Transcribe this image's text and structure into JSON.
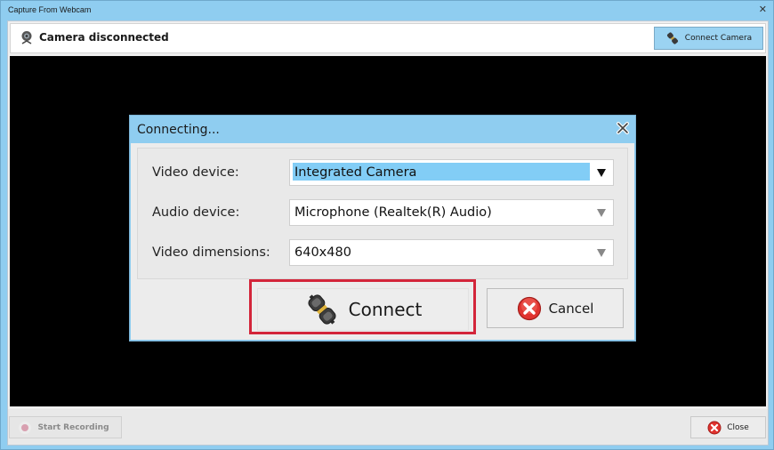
{
  "window": {
    "title": "Capture From Webcam",
    "close_glyph": "✕"
  },
  "topbar": {
    "status_icon": "webcam-icon",
    "status_text": "Camera disconnected",
    "connect_camera_icon": "plug-icon",
    "connect_camera_label": "Connect Camera"
  },
  "bottombar": {
    "start_recording_icon": "record-dot-icon",
    "start_recording_label": "Start Recording",
    "close_icon": "red-x-circle-icon",
    "close_label": "Close"
  },
  "dialog": {
    "title": "Connecting...",
    "close_icon": "close-icon",
    "fields": [
      {
        "label": "Video device:",
        "value": "Integrated Camera",
        "focused": true
      },
      {
        "label": "Audio device:",
        "value": "Microphone (Realtek(R) Audio)",
        "focused": false
      },
      {
        "label": "Video dimensions:",
        "value": "640x480",
        "focused": false
      }
    ],
    "connect_label": "Connect",
    "connect_icon": "plug-icon",
    "cancel_label": "Cancel",
    "cancel_icon": "red-x-circle-icon",
    "highlight_color": "#d3253a"
  }
}
